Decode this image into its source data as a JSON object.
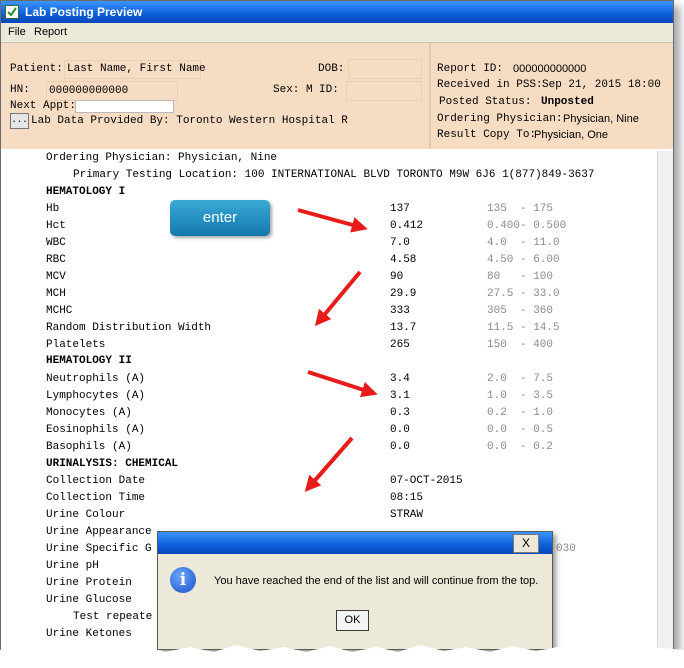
{
  "window": {
    "title": "Lab Posting Preview"
  },
  "menu": {
    "items": [
      "File",
      "Report"
    ]
  },
  "header": {
    "patient_label": "Patient:",
    "patient_name": "Last Name, First Name",
    "dob_label": "DOB:",
    "hn_label": "HN:",
    "hn_value": "000000000000",
    "sex_label": "Sex: M",
    "id_label": "ID:",
    "next_appt_label": "Next Appt:",
    "lab_button": "...",
    "lab_provider": "Lab Data Provided By: Toronto Western Hospital R",
    "report_id_label": "Report ID:",
    "report_id_value": "000000000000",
    "received_label": "Received in PSS:",
    "received_value": "Sep 21, 2015 18:00",
    "posted_label": "Posted Status:",
    "posted_value": "Unposted",
    "ordering_label": "Ordering Physician:",
    "ordering_value": "Physician, Nine",
    "result_label": "Result Copy To:",
    "result_value": "Physician, One"
  },
  "report": {
    "ordering_physician": "Ordering Physician:  Physician, Nine",
    "testing_location": "Primary Testing Location: 100 INTERNATIONAL BLVD TORONTO M9W 6J6 1(877)849-3637",
    "sections": {
      "hematology1": "HEMATOLOGY I",
      "hematology2": "HEMATOLOGY II",
      "urinalysis": "URINALYSIS: CHEMICAL"
    },
    "rows": [
      {
        "name": "Hb",
        "value": "137",
        "range": "135  - 175"
      },
      {
        "name": "Hct",
        "value": "0.412",
        "range": "0.400- 0.500"
      },
      {
        "name": "WBC",
        "value": "7.0",
        "range": "4.0  - 11.0"
      },
      {
        "name": "RBC",
        "value": "4.58",
        "range": "4.50 - 6.00"
      },
      {
        "name": "MCV",
        "value": "90",
        "range": "80   - 100"
      },
      {
        "name": "MCH",
        "value": "29.9",
        "range": "27.5 - 33.0"
      },
      {
        "name": "MCHC",
        "value": "333",
        "range": "305  - 360"
      },
      {
        "name": "Random Distribution Width",
        "value": "13.7",
        "range": "11.5 - 14.5"
      },
      {
        "name": "Platelets",
        "value": "265",
        "range": "150  - 400"
      },
      {
        "name": "Neutrophils (A)",
        "value": "3.4",
        "range": "2.0  - 7.5"
      },
      {
        "name": "Lymphocytes (A)",
        "value": "3.1",
        "range": "1.0  - 3.5"
      },
      {
        "name": "Monocytes (A)",
        "value": "0.3",
        "range": "0.2  - 1.0"
      },
      {
        "name": "Eosinophils (A)",
        "value": "0.0",
        "range": "0.0  - 0.5"
      },
      {
        "name": "Basophils (A)",
        "value": "0.0",
        "range": "0.0  - 0.2"
      },
      {
        "name": "Collection Date",
        "value": "07-OCT-2015",
        "range": ""
      },
      {
        "name": "Collection Time",
        "value": "08:15",
        "range": ""
      },
      {
        "name": "Urine Colour",
        "value": "STRAW",
        "range": ""
      },
      {
        "name": "Urine Appearance",
        "value": "",
        "range": ""
      },
      {
        "name": "Urine Specific G",
        "value": "",
        "range": "030"
      },
      {
        "name": "Urine pH",
        "value": "",
        "range": ""
      },
      {
        "name": "Urine Protein",
        "value": "",
        "range": ""
      },
      {
        "name": "Urine Glucose",
        "value": "",
        "range": ""
      },
      {
        "name": "Test repeate",
        "value": "",
        "range": ""
      },
      {
        "name": "Urine Ketones",
        "value": "",
        "range": ""
      }
    ]
  },
  "overlay": {
    "enter_label": "enter"
  },
  "dialog": {
    "message": "You have reached the end of the list and will continue from the top.",
    "ok_label": "OK",
    "close_label": "X"
  },
  "colors": {
    "header_bg": "#f5dcc2",
    "title_bar": "#0a5ed7",
    "arrow": "#e81b1b",
    "enter_button": "#1e8cc2"
  }
}
